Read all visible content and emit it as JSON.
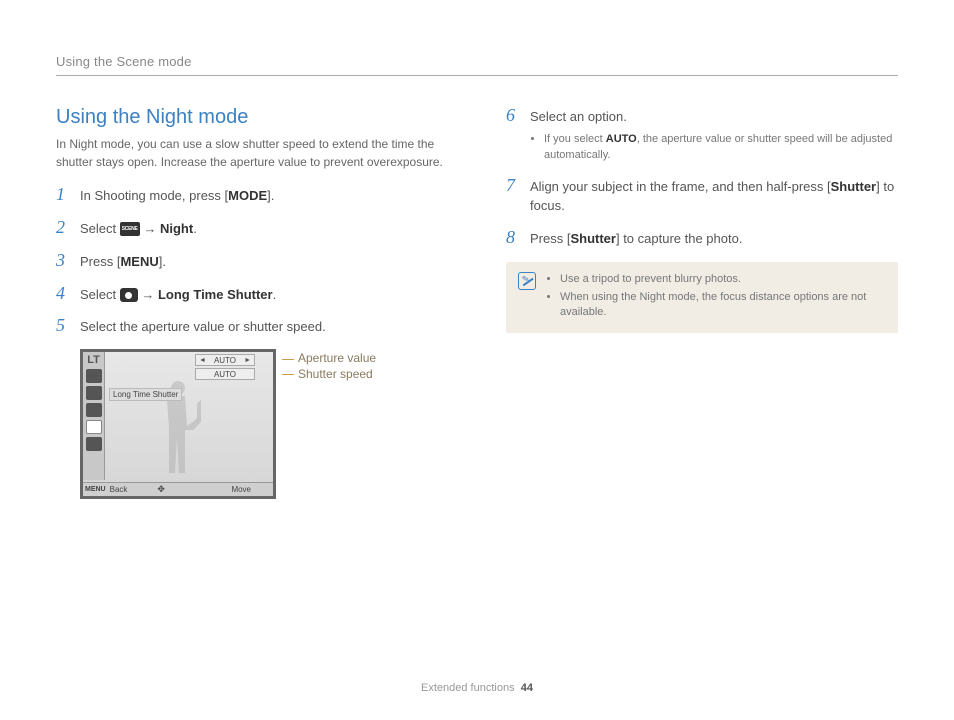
{
  "header": {
    "breadcrumb": "Using the Scene mode"
  },
  "title": "Using the Night mode",
  "intro": "In Night mode, you can use a slow shutter speed to extend the time the shutter stays open. Increase the aperture value to prevent overexposure.",
  "steps_left": [
    {
      "num": "1",
      "pre": "In Shooting mode, press [",
      "bold": "MODE",
      "post": "]."
    },
    {
      "num": "2",
      "pre": "Select ",
      "icon": "scene",
      "arrow": " → ",
      "bold": "Night",
      "post": "."
    },
    {
      "num": "3",
      "pre": "Press [",
      "bold": "MENU",
      "post": "]."
    },
    {
      "num": "4",
      "pre": "Select ",
      "icon": "camera",
      "arrow": " → ",
      "bold": "Long Time Shutter",
      "post": "."
    },
    {
      "num": "5",
      "pre": "Select the aperture value or shutter speed."
    }
  ],
  "lcd": {
    "lt": "LT",
    "auto1": "AUTO",
    "auto2": "AUTO",
    "label": "Long Time Shutter",
    "menu": "MENU",
    "back": "Back",
    "move": "Move"
  },
  "callouts": {
    "aperture": "Aperture value",
    "shutter": "Shutter speed"
  },
  "steps_right": [
    {
      "num": "6",
      "text": "Select an option.",
      "sub_pre": "If you select ",
      "sub_bold": "AUTO",
      "sub_post": ", the aperture value or shutter speed will be adjusted automatically."
    },
    {
      "num": "7",
      "pre": "Align your subject in the frame, and then half-press [",
      "bold": "Shutter",
      "post": "] to focus."
    },
    {
      "num": "8",
      "pre": "Press [",
      "bold": "Shutter",
      "post": "] to capture the photo."
    }
  ],
  "note": {
    "items": [
      "Use a tripod to prevent blurry photos.",
      "When using the Night mode, the focus distance options are not available."
    ]
  },
  "footer": {
    "section": "Extended functions",
    "page": "44"
  }
}
